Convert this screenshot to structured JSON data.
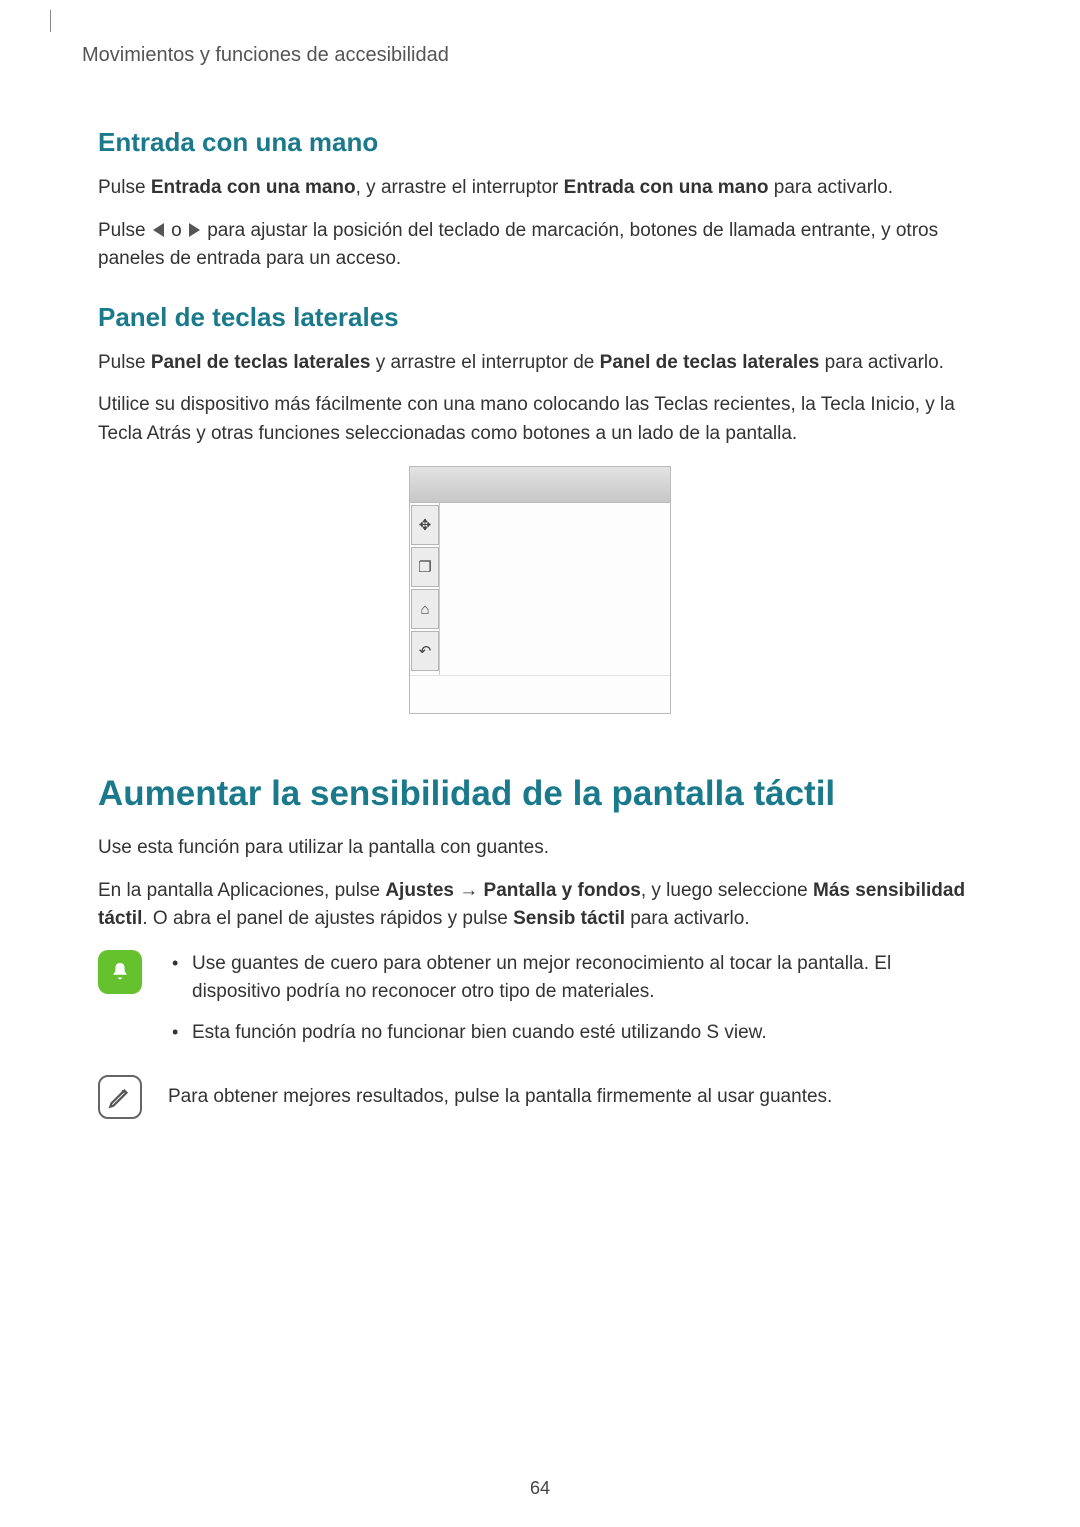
{
  "breadcrumb": "Movimientos y funciones de accesibilidad",
  "section1": {
    "title": "Entrada con una mano",
    "p1_a": "Pulse ",
    "p1_b": "Entrada con una mano",
    "p1_c": ", y arrastre el interruptor ",
    "p1_d": "Entrada con una mano",
    "p1_e": " para activarlo.",
    "p2_a": "Pulse ",
    "p2_b": " o ",
    "p2_c": " para ajustar la posición del teclado de marcación, botones de llamada entrante, y otros paneles de entrada para un acceso."
  },
  "section2": {
    "title": "Panel de teclas laterales",
    "p1_a": "Pulse ",
    "p1_b": "Panel de teclas laterales",
    "p1_c": " y arrastre el interruptor de ",
    "p1_d": "Panel de teclas laterales",
    "p1_e": " para activarlo.",
    "p2": "Utilice su dispositivo más fácilmente con una mano colocando las Teclas recientes, la Tecla Inicio, y la Tecla Atrás y otras funciones seleccionadas como botones a un lado de la pantalla."
  },
  "sidekeys": {
    "move": "✥",
    "recent": "❐",
    "home": "⌂",
    "back": "↶"
  },
  "section3": {
    "title": "Aumentar la sensibilidad de la pantalla táctil",
    "p1": "Use esta función para utilizar la pantalla con guantes.",
    "p2_a": "En la pantalla Aplicaciones, pulse ",
    "p2_b": "Ajustes",
    "p2_c": " → ",
    "p2_d": "Pantalla y fondos",
    "p2_e": ", y luego seleccione ",
    "p2_f": "Más sensibilidad táctil",
    "p2_g": ". O abra el panel de ajustes rápidos y pulse ",
    "p2_h": "Sensib táctil",
    "p2_i": " para activarlo."
  },
  "note1": {
    "li1": "Use guantes de cuero para obtener un mejor reconocimiento al tocar la pantalla. El dispositivo podría no reconocer otro tipo de materiales.",
    "li2": "Esta función podría no funcionar bien cuando esté utilizando S view."
  },
  "note2": {
    "text": "Para obtener mejores resultados, pulse la pantalla firmemente al usar guantes."
  },
  "page_number": "64"
}
